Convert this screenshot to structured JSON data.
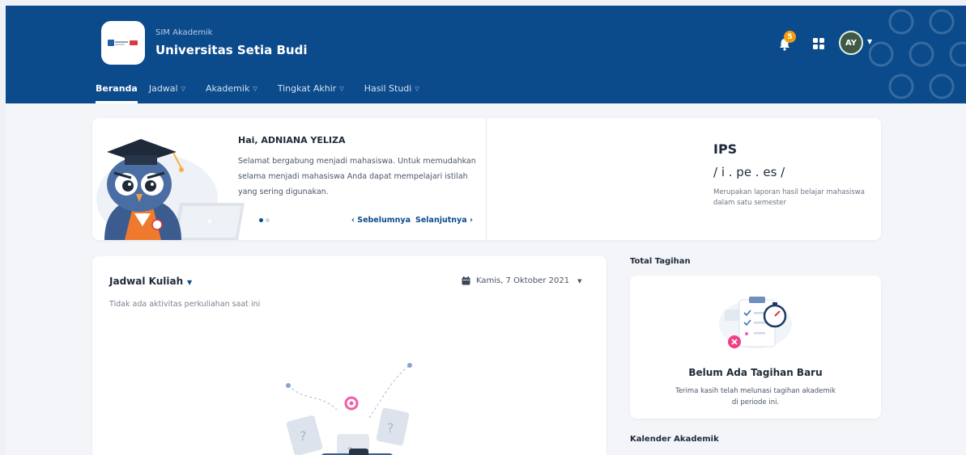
{
  "header": {
    "app_label": "SIM Akademik",
    "institution": "Universitas Setia Budi",
    "notification_count": "5",
    "user_initials": "AY",
    "bg_color": "#0b4a8b"
  },
  "nav": {
    "items": [
      {
        "label": "Beranda",
        "active": true
      },
      {
        "label": "Jadwal"
      },
      {
        "label": "Akademik"
      },
      {
        "label": "Tingkat Akhir"
      },
      {
        "label": "Hasil Studi"
      }
    ]
  },
  "welcome": {
    "greeting": "Hai, ADNIANA YELIZA",
    "message": "Selamat bergabung menjadi mahasiswa. Untuk memudahkan selama menjadi mahasiswa Anda dapat mempelajari istilah yang sering digunakan.",
    "prev_label": "‹ Sebelumnya",
    "next_label": "Selanjutnya ›",
    "slide_total": 2,
    "slide_active": 1,
    "term": "IPS",
    "phonetic": "/ i . pe . es /",
    "definition": "Merupakan laporan hasil belajar mahasiswa dalam satu semester"
  },
  "schedule": {
    "title": "Jadwal Kuliah",
    "date": "Kamis, 7 Oktober 2021",
    "empty_text": "Tidak ada aktivitas perkuliahan saat ini"
  },
  "sidebar": {
    "bill_section": "Total Tagihan",
    "bill_title": "Belum Ada Tagihan Baru",
    "bill_text": "Terima kasih telah melunasi tagihan akademik di periode ini.",
    "calendar_section": "Kalender Akademik"
  }
}
